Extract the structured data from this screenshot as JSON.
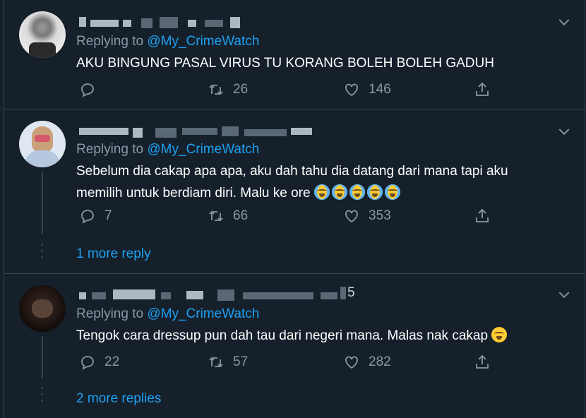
{
  "colors": {
    "background": "#15202b",
    "link": "#1da1f2",
    "muted": "#8899a6",
    "border": "#38444d"
  },
  "tweets": [
    {
      "replying_label": "Replying to",
      "handle": "@My_CrimeWatch",
      "text": "AKU BINGUNG PASAL VIRUS TU KORANG BOLEH BOLEH GADUH",
      "replies": "",
      "retweets": "26",
      "likes": "146",
      "name_suffix": ""
    },
    {
      "replying_label": "Replying to",
      "handle": "@My_CrimeWatch",
      "text_line1": "Sebelum dia cakap apa apa, aku dah tahu dia datang dari mana tapi aku",
      "text_line2": "memilih untuk berdiam diri. Malu ke ore",
      "emoji": [
        "loudly-crying-face",
        "loudly-crying-face",
        "loudly-crying-face",
        "loudly-crying-face",
        "loudly-crying-face"
      ],
      "replies": "7",
      "retweets": "66",
      "likes": "353",
      "more_replies": "1 more reply"
    },
    {
      "replying_label": "Replying to",
      "handle": "@My_CrimeWatch",
      "text": "Tengok cara dressup pun dah tau dari negeri mana. Malas nak cakap",
      "emoji": [
        "pensive-face"
      ],
      "replies": "22",
      "retweets": "57",
      "likes": "282",
      "name_suffix": "5",
      "more_replies": "2 more replies"
    }
  ],
  "icons": [
    "reply-icon",
    "retweet-icon",
    "like-icon",
    "share-icon",
    "chevron-down-icon"
  ]
}
